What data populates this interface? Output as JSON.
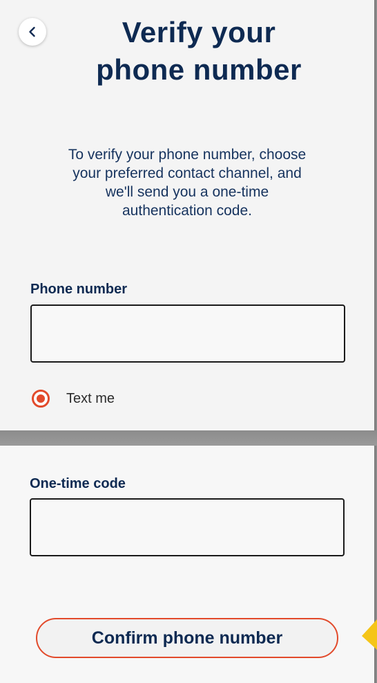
{
  "verify": {
    "title_line1": "Verify your",
    "title_line2": "phone number",
    "intro_line1": "To verify your phone number, choose",
    "intro_line2": "your preferred contact channel, and",
    "intro_line3": "we'll send you a one-time",
    "intro_line4": "authentication code.",
    "phone_label": "Phone number",
    "phone_value": "",
    "channel_option_label": "Text me",
    "channel_option_selected": true
  },
  "code": {
    "label": "One-time code",
    "value": ""
  },
  "actions": {
    "confirm_label": "Confirm phone number"
  },
  "icons": {
    "back": "chevron-left-icon",
    "pointer": "pointer-marker-icon"
  },
  "colors": {
    "brand_navy": "#0e2a52",
    "accent_orange": "#e24a2b",
    "pointer_yellow": "#f5c518"
  }
}
